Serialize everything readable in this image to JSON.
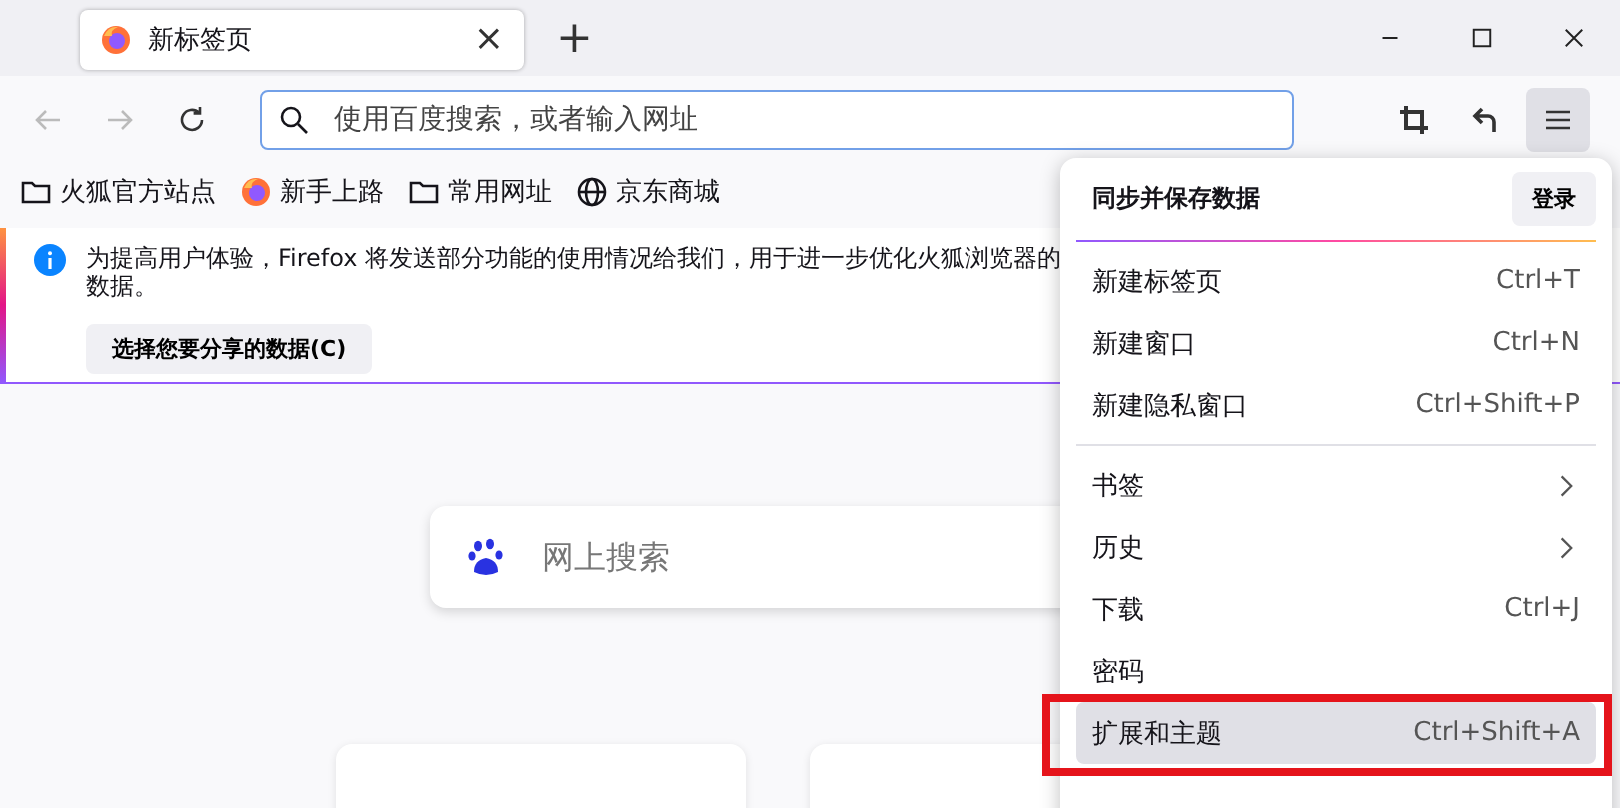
{
  "tab": {
    "title": "新标签页",
    "close": "×"
  },
  "new_tab_button": "+",
  "toolbar": {
    "back_disabled": true,
    "forward_disabled": true,
    "url_placeholder": "使用百度搜索，或者输入网址",
    "menu_open": true
  },
  "bookmarks": [
    {
      "kind": "folder",
      "label": "火狐官方站点"
    },
    {
      "kind": "firefox",
      "label": "新手上路"
    },
    {
      "kind": "folder",
      "label": "常用网址"
    },
    {
      "kind": "globe",
      "label": "京东商城"
    }
  ],
  "notification": {
    "lines": [
      "为提高用户体验，Firefox 将发送部分功能的使用情况给我们，用于进一步优化火狐浏览器的",
      "数据。"
    ],
    "button": "选择您要分享的数据(C)"
  },
  "search": {
    "placeholder": "网上搜索"
  },
  "menu": {
    "header": "同步并保存数据",
    "sign_in": "登录",
    "sections": [
      [
        {
          "kind": "shortcut",
          "label": "新建标签页",
          "shortcut": "Ctrl+T",
          "selected": false,
          "outlined": false
        },
        {
          "kind": "shortcut",
          "label": "新建窗口",
          "shortcut": "Ctrl+N",
          "selected": false,
          "outlined": false
        },
        {
          "kind": "shortcut",
          "label": "新建隐私窗口",
          "shortcut": "Ctrl+Shift+P",
          "selected": false,
          "outlined": false
        }
      ],
      [
        {
          "kind": "submenu",
          "label": "书签",
          "selected": false,
          "outlined": false
        },
        {
          "kind": "submenu",
          "label": "历史",
          "selected": false,
          "outlined": false
        },
        {
          "kind": "shortcut",
          "label": "下载",
          "shortcut": "Ctrl+J",
          "selected": false,
          "outlined": false
        },
        {
          "kind": "plain",
          "label": "密码",
          "selected": false,
          "outlined": false
        },
        {
          "kind": "shortcut",
          "label": "扩展和主题",
          "shortcut": "Ctrl+Shift+A",
          "selected": true,
          "outlined": true
        }
      ]
    ]
  }
}
